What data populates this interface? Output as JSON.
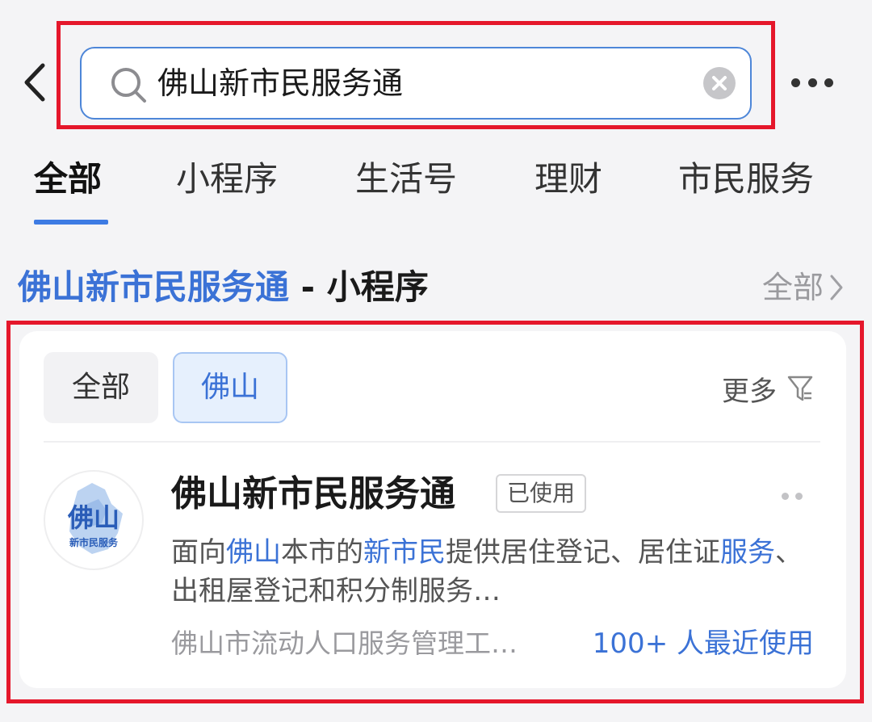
{
  "search": {
    "query": "佛山新市民服务通"
  },
  "tabs": [
    {
      "label": "全部",
      "active": true
    },
    {
      "label": "小程序",
      "active": false
    },
    {
      "label": "生活号",
      "active": false
    },
    {
      "label": "理财",
      "active": false
    },
    {
      "label": "市民服务",
      "active": false
    }
  ],
  "section": {
    "title_highlight": "佛山新市民服务通",
    "title_suffix": " - 小程序",
    "all_label": "全部"
  },
  "card": {
    "chips": [
      {
        "label": "全部",
        "selected": false
      },
      {
        "label": "佛山",
        "selected": true
      }
    ],
    "more_label": "更多",
    "app": {
      "logo_text": "佛山",
      "logo_subtext": "新市民服务",
      "name": "佛山新市民服务通",
      "badge": "已使用",
      "desc_parts": [
        {
          "text": "面向",
          "hl": false
        },
        {
          "text": "佛山",
          "hl": true
        },
        {
          "text": "本市的",
          "hl": false
        },
        {
          "text": "新市民",
          "hl": true
        },
        {
          "text": "提供居住登记、居住证",
          "hl": false
        },
        {
          "text": "服务",
          "hl": true
        },
        {
          "text": "、出租屋登记和积分制服务…",
          "hl": false
        }
      ],
      "provider": "佛山市流动人口服务管理工…",
      "usage": "100+ 人最近使用"
    }
  },
  "colors": {
    "accent": "#3b72d6",
    "highlight_box": "#e5172b"
  },
  "icons": {
    "back": "chevron-left-icon",
    "search": "search-icon",
    "clear": "clear-icon",
    "more": "more-dots-icon",
    "filter": "filter-icon",
    "section_more": "chevron-right-icon"
  }
}
